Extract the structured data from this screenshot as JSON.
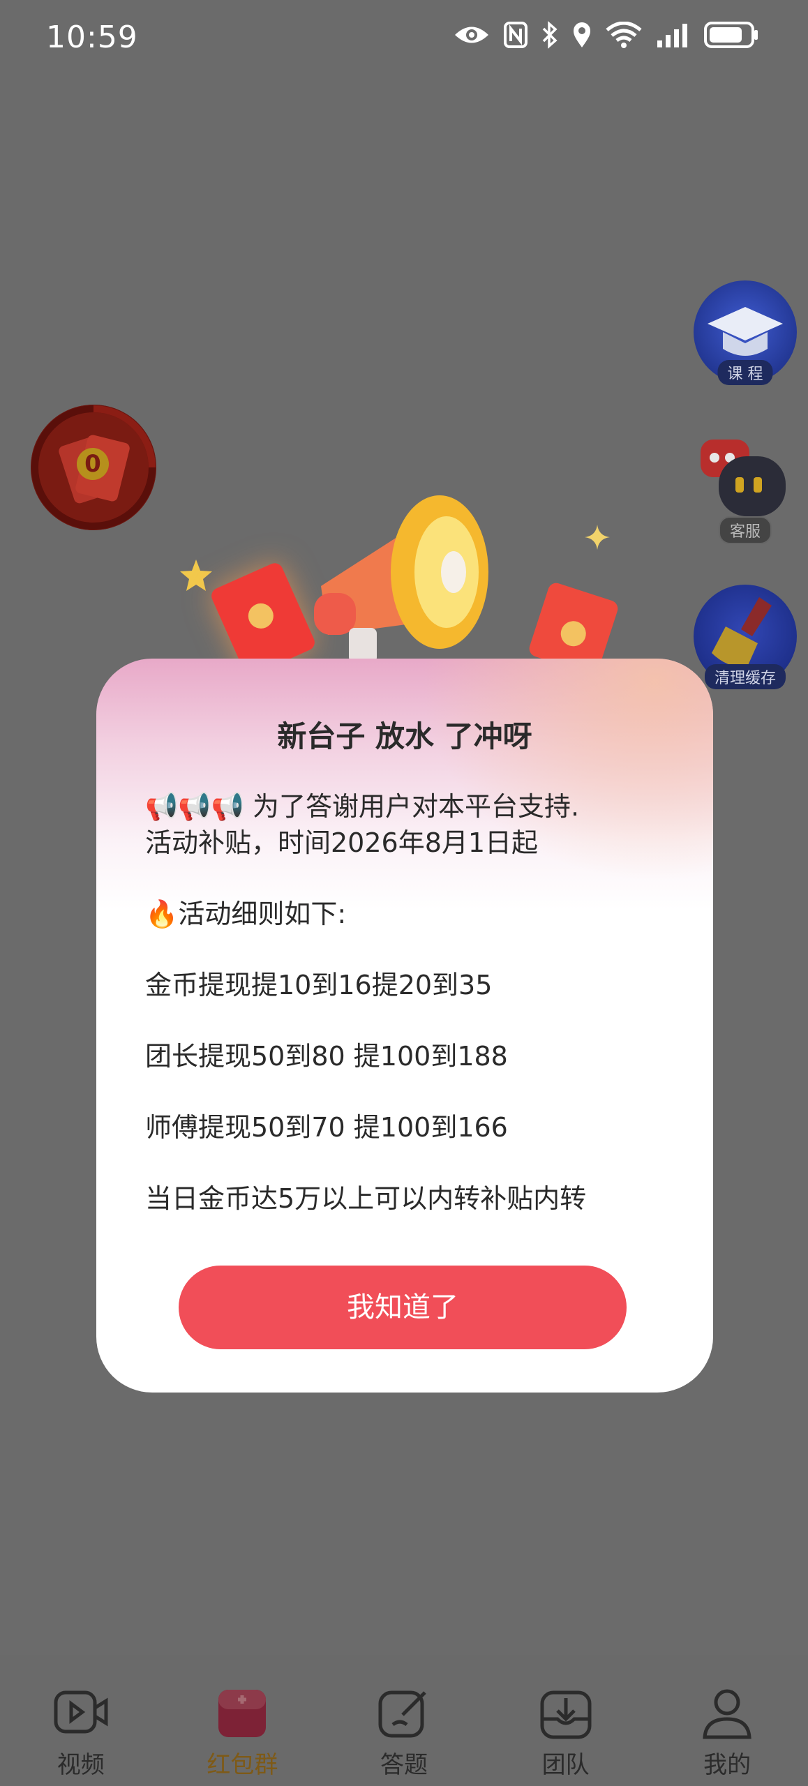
{
  "status_bar": {
    "time": "10:59",
    "icons": [
      "eye-icon",
      "nfc-icon",
      "bluetooth-icon",
      "location-icon",
      "wifi-icon",
      "signal-icon",
      "battery-icon"
    ]
  },
  "floating": {
    "hongbao_coin": "0",
    "course_label": "课 程",
    "service_label": "客服",
    "cache_label": "清理缓存"
  },
  "modal": {
    "title": "新台子 放水 了冲呀",
    "intro_line1": "📢📢📢 为了答谢用户对本平台支持.",
    "intro_line2": "活动补贴，时间2026年8月1日起",
    "rules_heading": "🔥活动细则如下:",
    "rules": [
      "金币提现提10到16提20到35",
      "团长提现50到80 提100到188",
      "师傅提现50到70 提100到166",
      "当日金币达5万以上可以内转补贴内转"
    ],
    "ok_button": "我知道了"
  },
  "bottom_nav": {
    "items": [
      {
        "label": "视频",
        "icon": "video-icon",
        "active": false
      },
      {
        "label": "红包群",
        "icon": "red-envelope-icon",
        "active": true
      },
      {
        "label": "答题",
        "icon": "quiz-icon",
        "active": false
      },
      {
        "label": "团队",
        "icon": "team-icon",
        "active": false
      },
      {
        "label": "我的",
        "icon": "profile-icon",
        "active": false
      }
    ]
  },
  "colors": {
    "overlay": "#6b6b6b",
    "button": "#f14e58",
    "active_tab": "#7e5a17"
  }
}
